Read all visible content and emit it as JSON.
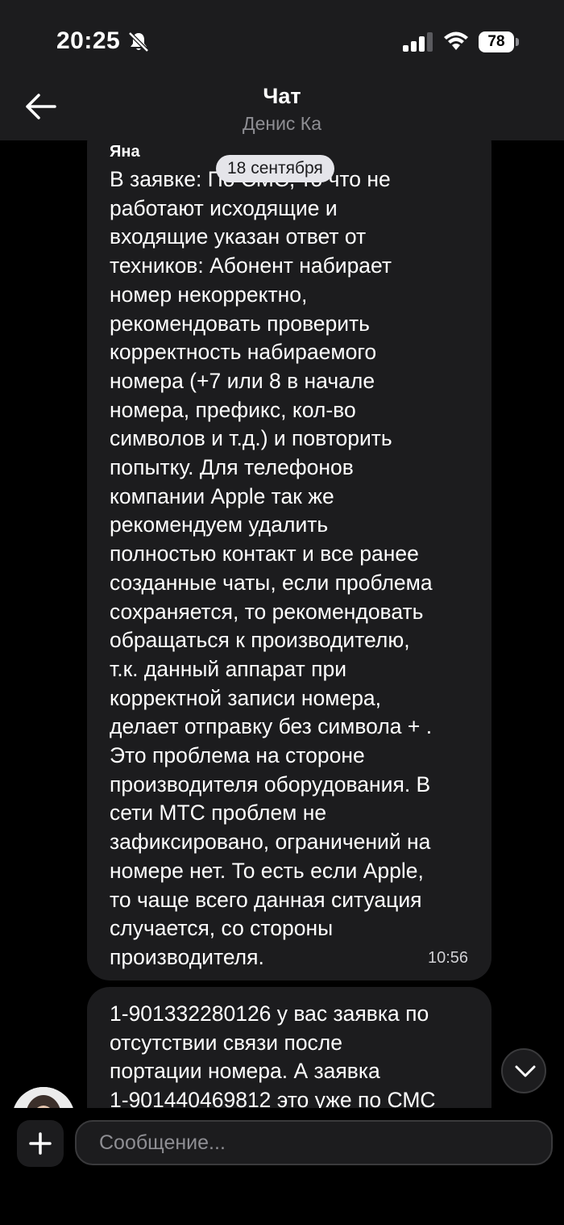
{
  "status_bar": {
    "time": "20:25",
    "battery": "78",
    "icons": [
      "bell-off-icon",
      "signal-icon",
      "wifi-icon",
      "battery-icon"
    ]
  },
  "header": {
    "title": "Чат",
    "subtitle": "Денис Ка",
    "back_icon": "arrow-left-icon"
  },
  "date_divider": "18 сентября",
  "messages": [
    {
      "sender": "Яна",
      "lines": [
        "В заявке: По СМС, то что не",
        "работают исходящие и",
        "входящие указан ответ от",
        "техников: Абонент набирает",
        "номер некорректно,",
        "рекомендовать проверить",
        "корректность набираемого",
        "номера (+7 или 8 в начале",
        "номера, префикс, кол-во",
        "символов и т.д.) и повторить",
        "попытку. Для телефонов",
        "компании Apple так же",
        "рекомендуем удалить",
        "полностью контакт и все ранее",
        "созданные чаты, если проблема",
        "сохраняется, то рекомендовать",
        "обращаться к производителю,",
        "т.к. данный аппарат при",
        "корректной записи номера,",
        "делает отправку без символа + .",
        "Это проблема на стороне",
        "производителя оборудования. В",
        "сети МТС проблем не",
        "зафиксировано, ограничений на",
        "номере нет. То есть если Apple,",
        "то чаще всего данная ситуация",
        "случается, со стороны",
        "производителя."
      ],
      "time": "10:56"
    },
    {
      "lines": [
        "1-901332280126 у вас заявка по",
        "отсутствии связи после",
        "портации номера. А заявка",
        "1-901440469812 это уже по СМС"
      ]
    }
  ],
  "composer": {
    "placeholder": "Сообщение..."
  }
}
